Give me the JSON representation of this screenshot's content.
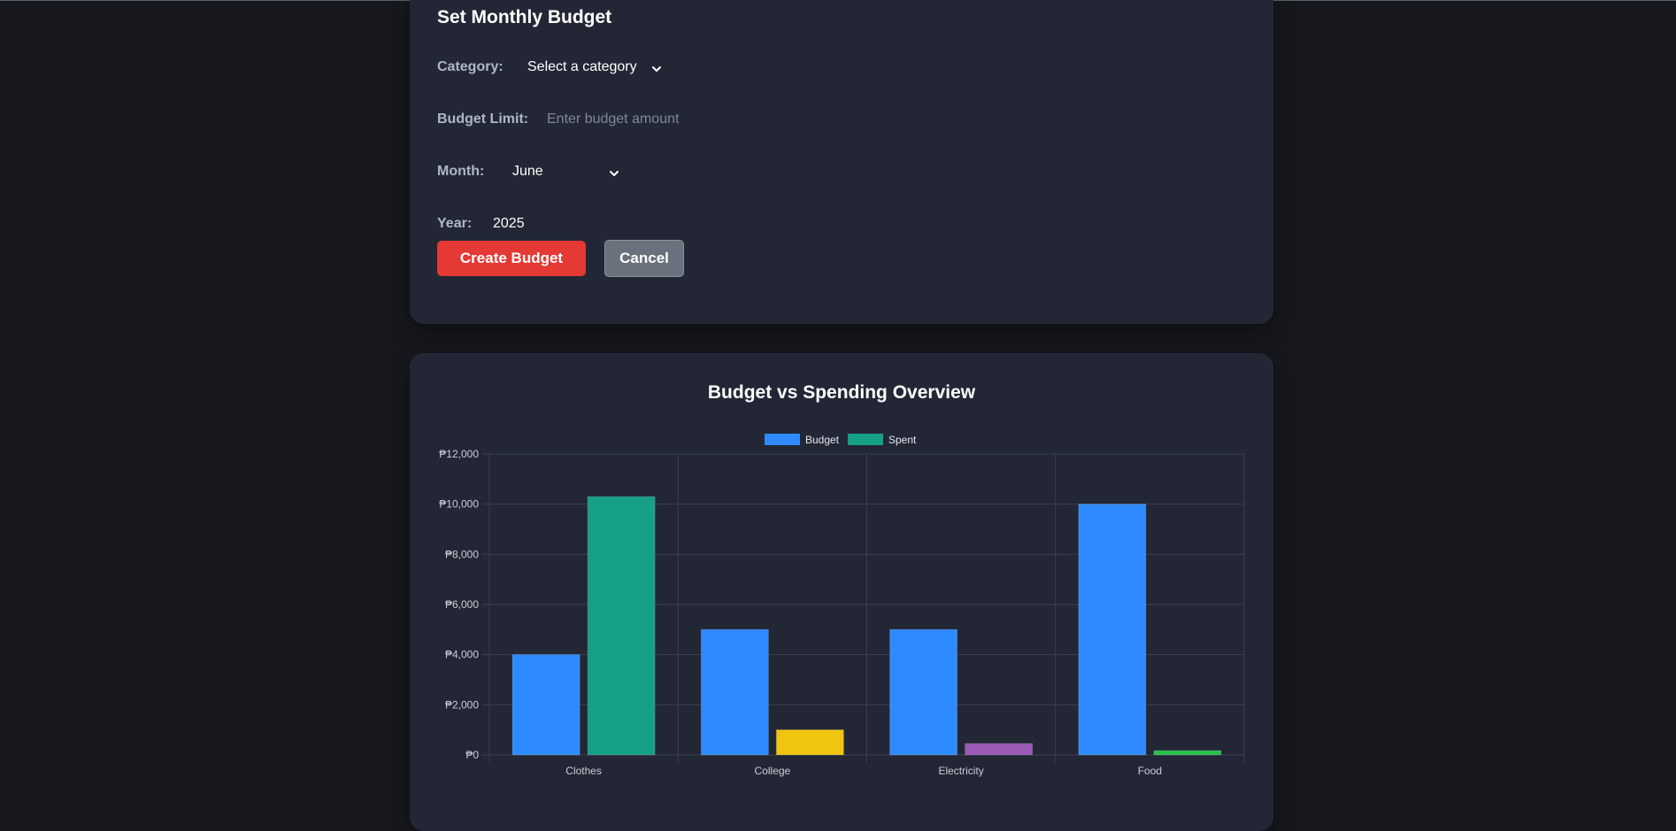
{
  "form": {
    "title": "Set Monthly Budget",
    "category_label": "Category:",
    "category_value": "Select a category",
    "budget_label": "Budget Limit:",
    "budget_placeholder": "Enter budget amount",
    "month_label": "Month:",
    "month_value": "June",
    "year_label": "Year:",
    "year_value": "2025",
    "create_button": "Create Budget",
    "cancel_button": "Cancel"
  },
  "chart_data": {
    "type": "bar",
    "title": "Budget vs Spending Overview",
    "categories": [
      "Clothes",
      "College",
      "Electricity",
      "Food"
    ],
    "series": [
      {
        "name": "Budget",
        "values": [
          4000,
          5000,
          5000,
          10000
        ],
        "color": "#2e8bff"
      },
      {
        "name": "Spent",
        "values": [
          10300,
          1000,
          450,
          170
        ],
        "colors": [
          "#16a085",
          "#f1c40f",
          "#9b59b6",
          "#27c24c"
        ]
      }
    ],
    "ylim": [
      0,
      12000
    ],
    "yticks": [
      "₱0",
      "₱2,000",
      "₱4,000",
      "₱6,000",
      "₱8,000",
      "₱10,000",
      "₱12,000"
    ],
    "legend": "top-center",
    "grid": true
  }
}
